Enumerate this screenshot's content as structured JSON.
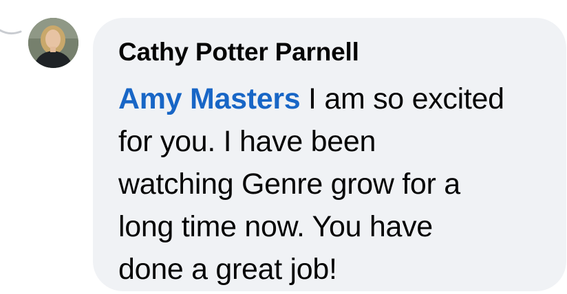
{
  "comment": {
    "author_name": "Cathy Potter Parnell",
    "mention": "Amy Masters",
    "text_lines": [
      " I am so excited",
      "for you.  I have been",
      "watching Genre grow for a",
      "long time now.  You have",
      "done a great job!"
    ]
  },
  "colors": {
    "bubble_background": "#f0f2f5",
    "mention_color": "#1866c6",
    "text_color": "#050505"
  }
}
